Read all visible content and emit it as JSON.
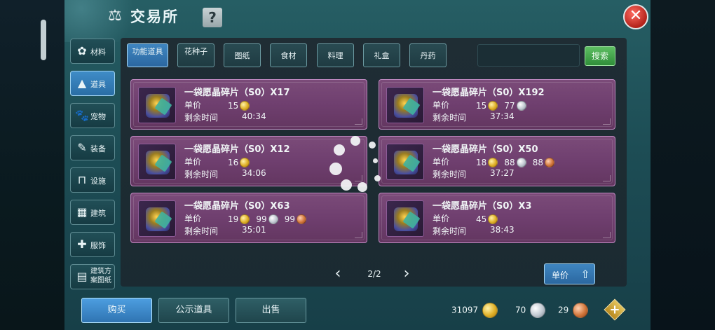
{
  "header": {
    "title": "交易所",
    "help_label": "?",
    "close_label": "✕"
  },
  "sidebar": {
    "items": [
      {
        "label": "材料",
        "icon": "materials-icon",
        "glyph": "✿",
        "active": false
      },
      {
        "label": "道具",
        "icon": "items-icon",
        "glyph": "▲",
        "active": true
      },
      {
        "label": "宠物",
        "icon": "paw-icon",
        "glyph": "🐾",
        "active": false
      },
      {
        "label": "装备",
        "icon": "equipment-icon",
        "glyph": "✎",
        "active": false
      },
      {
        "label": "设施",
        "icon": "facility-icon",
        "glyph": "⊓",
        "active": false
      },
      {
        "label": "建筑",
        "icon": "building-icon",
        "glyph": "▦",
        "active": false
      },
      {
        "label": "服饰",
        "icon": "clothing-icon",
        "glyph": "✚",
        "active": false
      },
      {
        "label": "建筑方案图纸",
        "icon": "blueprint-icon",
        "glyph": "▤",
        "active": false
      }
    ]
  },
  "tabs": [
    {
      "label": "功能道具",
      "active": true
    },
    {
      "label": "花种子",
      "active": false
    },
    {
      "label": "图纸",
      "active": false
    },
    {
      "label": "食材",
      "active": false
    },
    {
      "label": "料理",
      "active": false
    },
    {
      "label": "礼盒",
      "active": false
    },
    {
      "label": "丹药",
      "active": false
    }
  ],
  "search": {
    "button_label": "搜索",
    "value": ""
  },
  "listing_labels": {
    "price": "单价",
    "time": "剩余时间"
  },
  "listings": [
    {
      "name": "一袋愿晶碎片（S0）X17",
      "price": [
        {
          "amount": "15",
          "coin": "gold"
        }
      ],
      "time": "40:34"
    },
    {
      "name": "一袋愿晶碎片（S0）X192",
      "price": [
        {
          "amount": "15",
          "coin": "gold"
        },
        {
          "amount": "77",
          "coin": "silver"
        }
      ],
      "time": "37:34"
    },
    {
      "name": "一袋愿晶碎片（S0）X12",
      "price": [
        {
          "amount": "16",
          "coin": "gold"
        }
      ],
      "time": "34:06"
    },
    {
      "name": "一袋愿晶碎片（S0）X50",
      "price": [
        {
          "amount": "18",
          "coin": "gold"
        },
        {
          "amount": "88",
          "coin": "silver"
        },
        {
          "amount": "88",
          "coin": "bronze"
        }
      ],
      "time": "37:27"
    },
    {
      "name": "一袋愿晶碎片（S0）X63",
      "price": [
        {
          "amount": "19",
          "coin": "gold"
        },
        {
          "amount": "99",
          "coin": "silver"
        },
        {
          "amount": "99",
          "coin": "bronze"
        }
      ],
      "time": "35:01"
    },
    {
      "name": "一袋愿晶碎片（S0）X3",
      "price": [
        {
          "amount": "45",
          "coin": "gold"
        }
      ],
      "time": "38:43"
    }
  ],
  "pagination": {
    "prev": "‹",
    "page": "2/2",
    "next": "›"
  },
  "sort": {
    "label": "单价"
  },
  "bottom_tabs": [
    {
      "label": "购买",
      "active": true
    },
    {
      "label": "公示道具",
      "active": false
    },
    {
      "label": "出售",
      "active": false
    }
  ],
  "wallet": {
    "gold": "31097",
    "silver": "70",
    "bronze": "29",
    "add_label": "+"
  }
}
